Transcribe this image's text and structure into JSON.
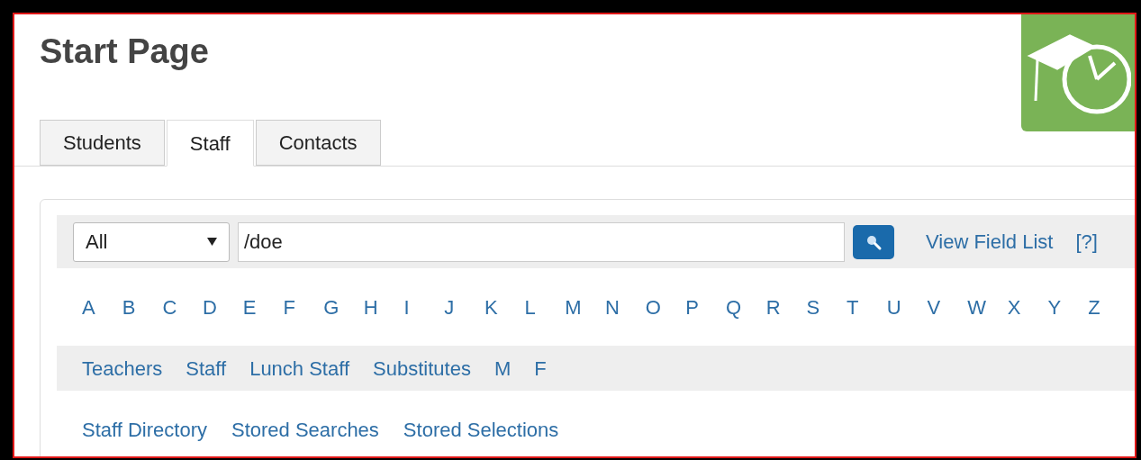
{
  "page_title": "Start Page",
  "tabs": [
    {
      "label": "Students",
      "selected": false
    },
    {
      "label": "Staff",
      "selected": true
    },
    {
      "label": "Contacts",
      "selected": false
    }
  ],
  "search": {
    "scope": "All",
    "value": "/doe",
    "field_list_link": "View Field List",
    "help_link": "[?]"
  },
  "letters": [
    "A",
    "B",
    "C",
    "D",
    "E",
    "F",
    "G",
    "H",
    "I",
    "J",
    "K",
    "L",
    "M",
    "N",
    "O",
    "P",
    "Q",
    "R",
    "S",
    "T",
    "U",
    "V",
    "W",
    "X",
    "Y",
    "Z"
  ],
  "groups": [
    "Teachers",
    "Staff",
    "Lunch Staff",
    "Substitutes",
    "M",
    "F"
  ],
  "links": [
    "Staff Directory",
    "Stored Searches",
    "Stored Selections"
  ]
}
